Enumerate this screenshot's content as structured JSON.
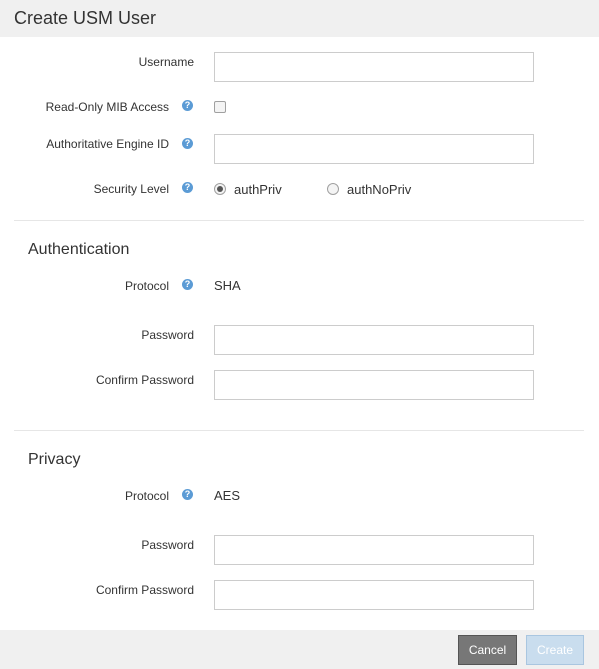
{
  "dialog": {
    "title": "Create USM User"
  },
  "fields": {
    "username": {
      "label": "Username",
      "value": ""
    },
    "read_only_mib": {
      "label": "Read-Only MIB Access",
      "checked": false
    },
    "engine_id": {
      "label": "Authoritative Engine ID",
      "value": ""
    },
    "security_level": {
      "label": "Security Level",
      "options": [
        {
          "label": "authPriv",
          "selected": true
        },
        {
          "label": "authNoPriv",
          "selected": false
        }
      ]
    }
  },
  "authentication": {
    "title": "Authentication",
    "protocol_label": "Protocol",
    "protocol_value": "SHA",
    "password_label": "Password",
    "confirm_label": "Confirm Password"
  },
  "privacy": {
    "title": "Privacy",
    "protocol_label": "Protocol",
    "protocol_value": "AES",
    "password_label": "Password",
    "confirm_label": "Confirm Password"
  },
  "help_icon_glyph": "?",
  "footer": {
    "cancel_label": "Cancel",
    "create_label": "Create"
  }
}
